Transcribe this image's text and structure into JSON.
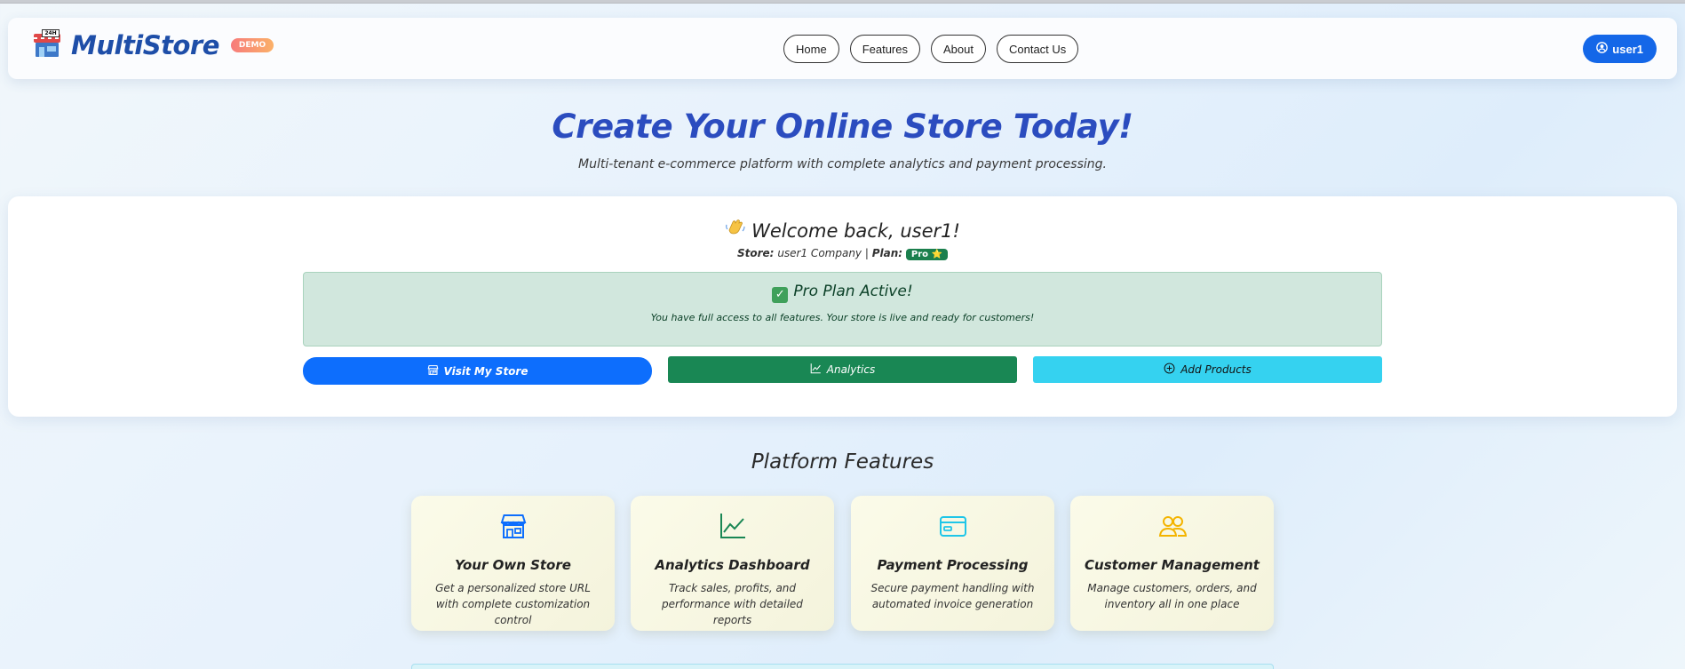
{
  "navbar": {
    "brand": "MultiStore",
    "logo_tag": "24H",
    "demo_badge": "DEMO",
    "links": [
      "Home",
      "Features",
      "About",
      "Contact Us"
    ],
    "user_label": "user1"
  },
  "hero": {
    "title": "Create Your Online Store Today!",
    "subtitle": "Multi-tenant e-commerce platform with complete analytics and payment processing."
  },
  "welcome": {
    "title": "Welcome back, user1!",
    "store_label": "Store:",
    "store_name": "user1 Company",
    "separator": "|",
    "plan_label": "Plan:",
    "plan_value": "Pro ⭐"
  },
  "plan_alert": {
    "title": "Pro Plan Active!",
    "text": "You have full access to all features. Your store is live and ready for customers!"
  },
  "actions": {
    "visit": "Visit My Store",
    "analytics": "Analytics",
    "add_products": "Add Products"
  },
  "features": {
    "title": "Platform Features",
    "items": [
      {
        "title": "Your Own Store",
        "desc": "Get a personalized store URL with complete customization control",
        "icon": "shop-icon",
        "color": "#0d6efd"
      },
      {
        "title": "Analytics Dashboard",
        "desc": "Track sales, profits, and performance with detailed reports",
        "icon": "chart-line-icon",
        "color": "#198754"
      },
      {
        "title": "Payment Processing",
        "desc": "Secure payment handling with automated invoice generation",
        "icon": "credit-card-icon",
        "color": "#1fc6e8"
      },
      {
        "title": "Customer Management",
        "desc": "Manage customers, orders, and inventory all in one place",
        "icon": "people-icon",
        "color": "#f4b400"
      }
    ]
  },
  "colors": {
    "primary": "#0d6efd",
    "success": "#198754",
    "info": "#35d2f0",
    "brand": "#1e4ea8",
    "hero": "#2b4cbf"
  }
}
